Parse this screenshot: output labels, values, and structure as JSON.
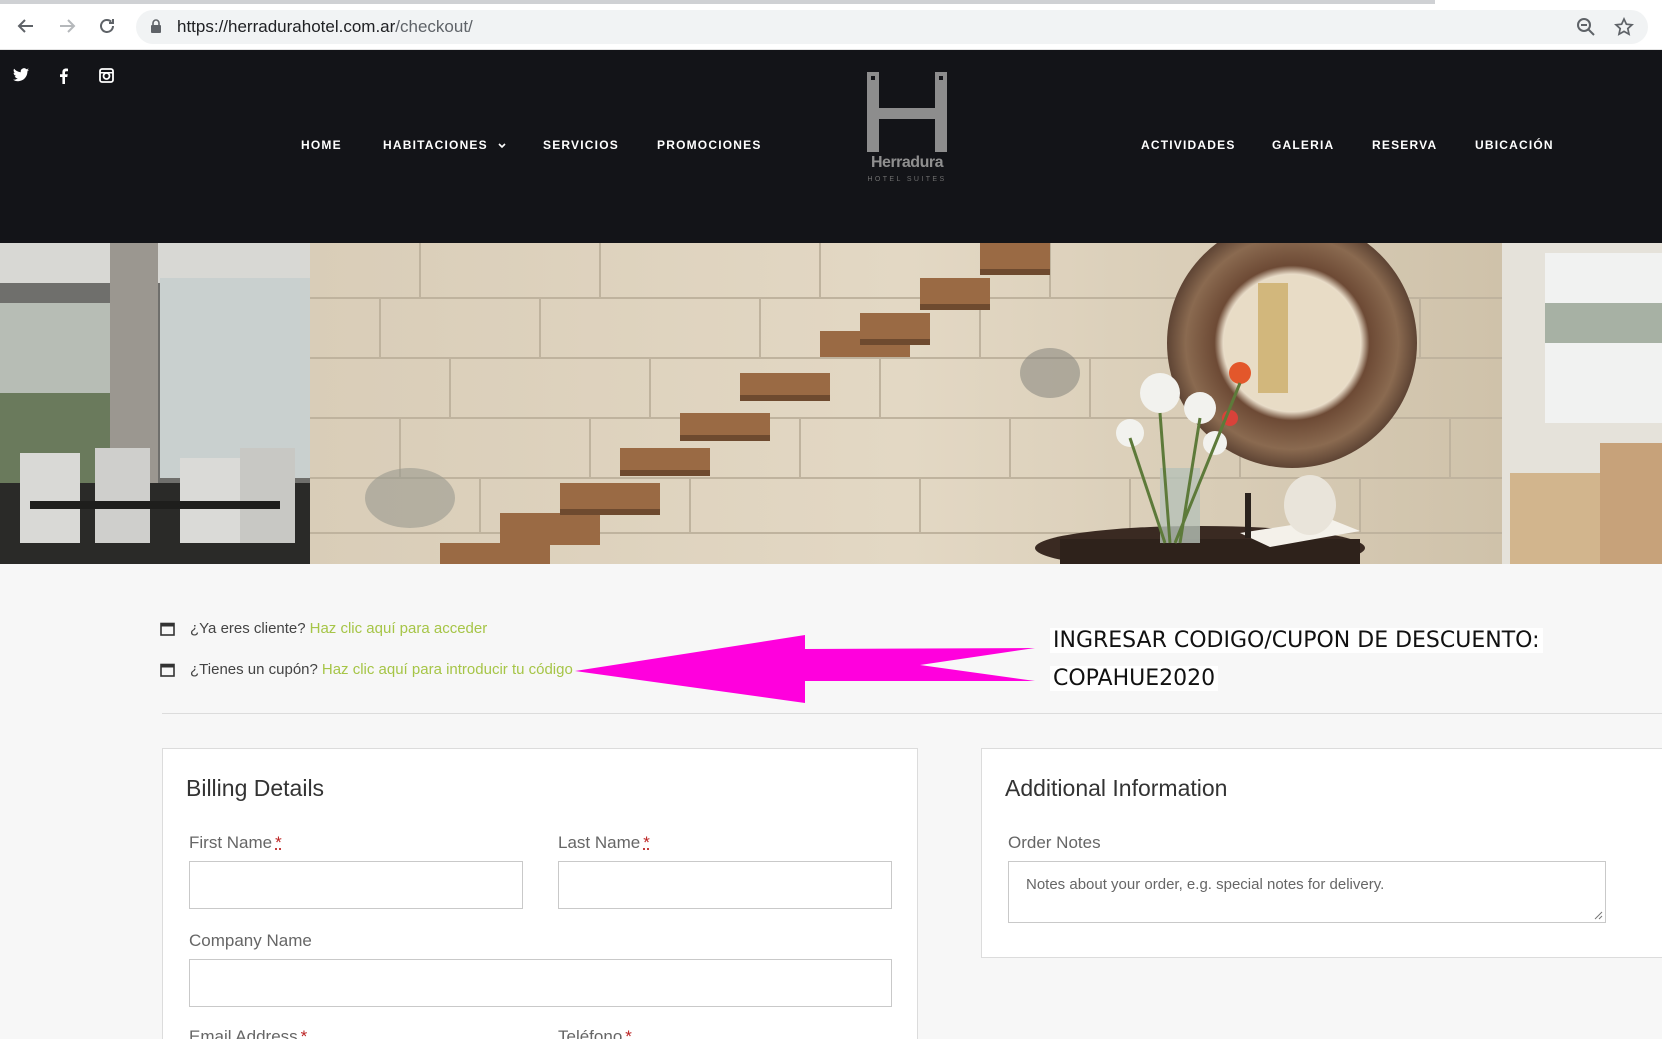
{
  "browser": {
    "url_host": "https://herradurahotel.com.ar",
    "url_path": "/checkout/"
  },
  "header": {
    "social": [
      "twitter-icon",
      "facebook-icon",
      "instagram-icon"
    ],
    "nav_left": [
      "HOME",
      "HABITACIONES",
      "SERVICIOS",
      "PROMOCIONES"
    ],
    "nav_right": [
      "ACTIVIDADES",
      "GALERIA",
      "RESERVA",
      "UBICACIÓN"
    ],
    "logo": {
      "word": "Herradura",
      "sub": "HOTEL SUITES"
    }
  },
  "notices": {
    "login_text": "¿Ya eres cliente?",
    "login_link": "Haz clic aquí para acceder",
    "coupon_text": "¿Tienes un cupón?",
    "coupon_link": "Haz clic aquí para introducir tu código"
  },
  "annotation": {
    "line1": "INGRESAR CODIGO/CUPON DE DESCUENTO:",
    "line2": "COPAHUE2020",
    "arrow_color": "#ff00dd"
  },
  "billing": {
    "title": "Billing Details",
    "first_name_label": "First Name",
    "last_name_label": "Last Name",
    "company_label": "Company Name",
    "email_label": "Email Address",
    "phone_label": "Teléfono",
    "required_mark": "*"
  },
  "additional": {
    "title": "Additional Information",
    "notes_label": "Order Notes",
    "notes_placeholder": "Notes about your order, e.g. special notes for delivery."
  },
  "colors": {
    "header_bg": "#131418",
    "link": "#a6c547",
    "page_bg": "#f7f7f7"
  }
}
